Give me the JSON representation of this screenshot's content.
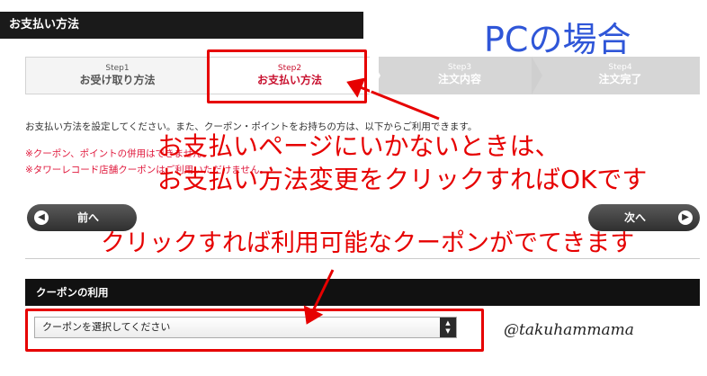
{
  "header": {
    "title": "お支払い方法"
  },
  "annotation": {
    "pc_title": "PCの場合",
    "line1": "お支払いページにいかないときは、",
    "line2": "お支払い方法変更をクリックすればOKです",
    "line3": "クリックすれば利用可能なクーポンがでてきます",
    "signature": "@takuhammama",
    "highlight_color": "#e60000",
    "title_color": "#2f56d8"
  },
  "steps": [
    {
      "num": "Step1",
      "name": "お受け取り方法",
      "state": "done"
    },
    {
      "num": "Step2",
      "name": "お支払い方法",
      "state": "current"
    },
    {
      "num": "Step3",
      "name": "注文内容",
      "state": "upcoming"
    },
    {
      "num": "Step4",
      "name": "注文完了",
      "state": "upcoming"
    }
  ],
  "info_text": "お支払い方法を設定してください。また、クーポン・ポイントをお持ちの方は、以下からご利用できます。",
  "notices": [
    "※クーポン、ポイントの併用はできません。",
    "※タワーレコード店舗クーポンはご利用いただけません。"
  ],
  "nav": {
    "prev_label": "前へ",
    "next_label": "次へ",
    "prev_icon": "chevron-left-icon",
    "next_icon": "chevron-right-icon"
  },
  "coupon": {
    "section_title": "クーポンの利用",
    "select_value": "クーポンを選択してください"
  }
}
